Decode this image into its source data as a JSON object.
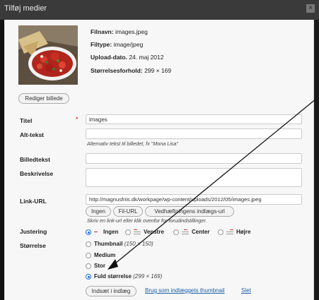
{
  "window": {
    "title": "Tilføj medier"
  },
  "file_info": {
    "filename_label": "Filnavn:",
    "filename": "images.jpeg",
    "filetype_label": "Filtype:",
    "filetype": "image/jpeg",
    "upload_label": "Upload-dato.",
    "upload": "24. maj 2012",
    "ratio_label": "Størrelsesforhold:",
    "ratio": "299 × 169"
  },
  "edit_image_button": "Rediger billede",
  "fields": {
    "title_label": "Titel",
    "title_value": "images",
    "required_mark": "*",
    "alt_label": "Alt-tekst",
    "alt_help": "Alternativ tekst til billedet, fx \"Mona Lisa\"",
    "caption_label": "Billedtekst",
    "description_label": "Beskrivelse",
    "link_label": "Link-URL",
    "link_value": "http://magnusfriis.dk/workpage/wp-content/uploads/2012/05/images.jpeg",
    "link_buttons": [
      "Ingen",
      "Fil-URL",
      "Vedhæftningens indlægs-url"
    ],
    "link_help": "Skriv en link-url eller klik ovenfor for forudindstillinger."
  },
  "alignment": {
    "label": "Justering",
    "options": [
      "Ingen",
      "Venstre",
      "Center",
      "Højre"
    ],
    "selected": "Ingen"
  },
  "size": {
    "label": "Størrelse",
    "options": [
      {
        "name": "Thumbnail",
        "dims": "(150 × 150)"
      },
      {
        "name": "Medium",
        "dims": ""
      },
      {
        "name": "Stor",
        "dims": ""
      },
      {
        "name": "Fuld størrelse",
        "dims": "(299 × 169)"
      }
    ],
    "selected": "Fuld størrelse"
  },
  "actions": {
    "insert": "Indsæt i indlæg",
    "use_thumbnail": "Brug som indlæggets thumbnail",
    "delete": "Slet"
  }
}
